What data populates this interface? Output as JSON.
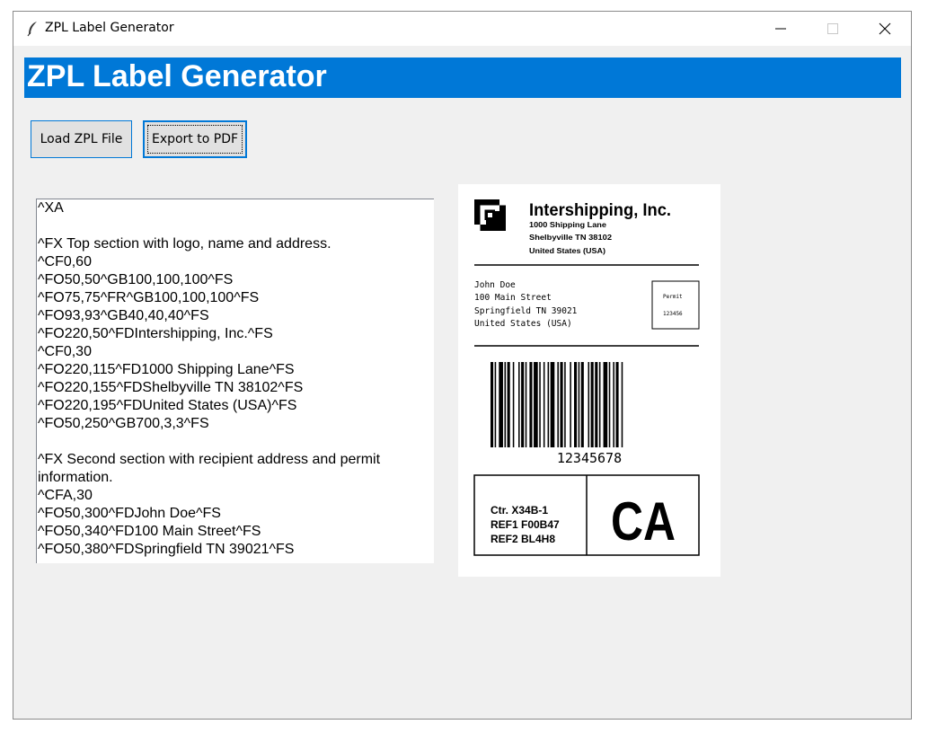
{
  "window": {
    "title": "ZPL Label Generator",
    "icon": "feather-icon"
  },
  "header": {
    "title": "ZPL Label Generator",
    "background": "#0078d7"
  },
  "toolbar": {
    "load_label": "Load ZPL File",
    "export_label": "Export to PDF"
  },
  "editor": {
    "lines": [
      "^XA",
      "",
      "^FX Top section with logo, name and address.",
      "^CF0,60",
      "^FO50,50^GB100,100,100^FS",
      "^FO75,75^FR^GB100,100,100^FS",
      "^FO93,93^GB40,40,40^FS",
      "^FO220,50^FDIntershipping, Inc.^FS",
      "^CF0,30",
      "^FO220,115^FD1000 Shipping Lane^FS",
      "^FO220,155^FDShelbyville TN 38102^FS",
      "^FO220,195^FDUnited States (USA)^FS",
      "^FO50,250^GB700,3,3^FS",
      "",
      "^FX Second section with recipient address and permit",
      "information.",
      "^CFA,30",
      "^FO50,300^FDJohn Doe^FS",
      "^FO50,340^FD100 Main Street^FS",
      "^FO50,380^FDSpringfield TN 39021^FS"
    ]
  },
  "label": {
    "company": "Intershipping, Inc.",
    "address1": "1000 Shipping Lane",
    "address2": "Shelbyville TN 38102",
    "address3": "United States (USA)",
    "recipient": [
      "John Doe",
      "100 Main Street",
      "Springfield TN 39021",
      "United States (USA)"
    ],
    "permit_label": "Permit",
    "permit_number": "123456",
    "barcode_text": "12345678",
    "ctr": "Ctr. X34B-1",
    "ref1": "REF1 F00B47",
    "ref2": "REF2 BL4H8",
    "state": "CA"
  }
}
